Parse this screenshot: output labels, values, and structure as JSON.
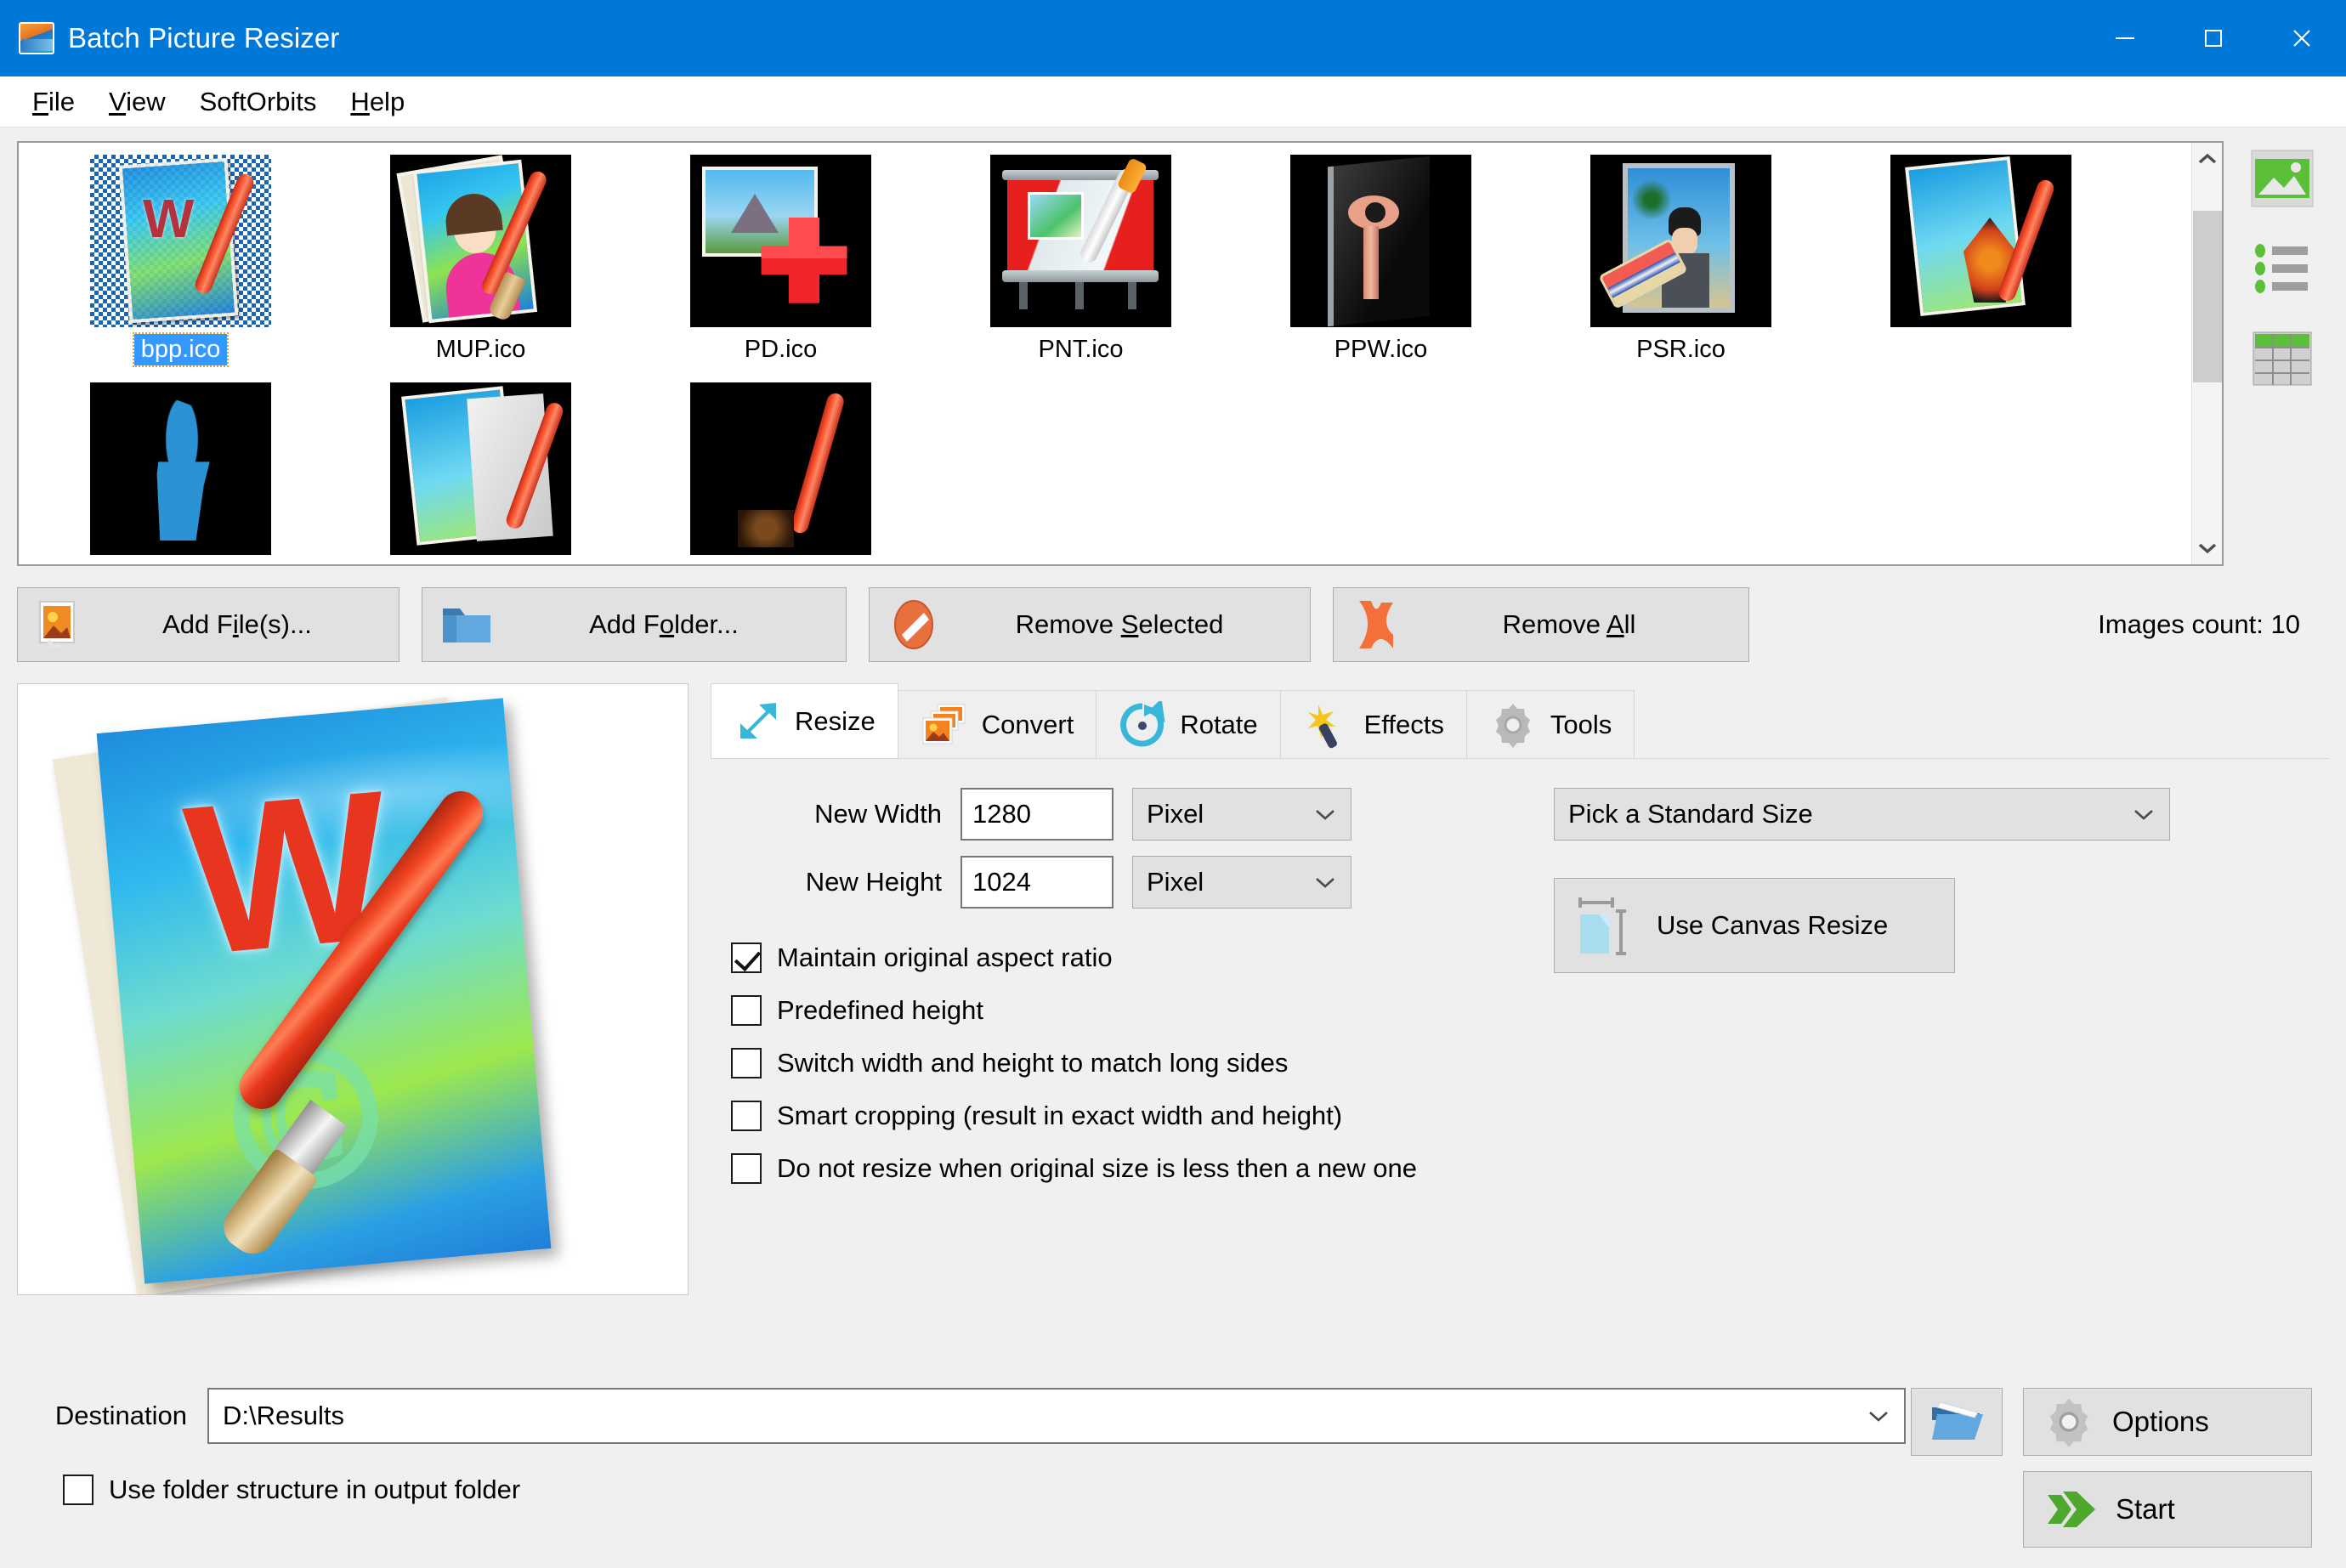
{
  "window": {
    "title": "Batch Picture Resizer",
    "icon": "app-image-icon",
    "minimize": "—",
    "maximize": "□",
    "close": "✕"
  },
  "menu": {
    "items": [
      {
        "label": "File",
        "accel": "F"
      },
      {
        "label": "View",
        "accel": "V"
      },
      {
        "label": "SoftOrbits",
        "accel": ""
      },
      {
        "label": "Help",
        "accel": "H"
      }
    ]
  },
  "thumbnails": {
    "items": [
      {
        "name": "bpp.ico",
        "selected": true
      },
      {
        "name": "MUP.ico",
        "selected": false
      },
      {
        "name": "PD.ico",
        "selected": false
      },
      {
        "name": "PNT.ico",
        "selected": false
      },
      {
        "name": "PPW.ico",
        "selected": false
      },
      {
        "name": "PSR.ico",
        "selected": false
      }
    ],
    "scrollbar": {
      "up": "chevron-up",
      "down": "chevron-down"
    }
  },
  "view_tools": {
    "items": [
      {
        "name": "thumbnail-view",
        "active": true
      },
      {
        "name": "list-view",
        "active": false
      },
      {
        "name": "details-view",
        "active": false
      }
    ]
  },
  "actions": {
    "add_files": "Add File(s)...",
    "add_folder": "Add Folder...",
    "remove_selected": "Remove Selected",
    "remove_all": "Remove All",
    "images_count": "Images count: 10"
  },
  "tabs": [
    {
      "label": "Resize",
      "icon": "resize-arrow-icon",
      "active": true
    },
    {
      "label": "Convert",
      "icon": "convert-photos-icon",
      "active": false
    },
    {
      "label": "Rotate",
      "icon": "rotate-arrow-icon",
      "active": false
    },
    {
      "label": "Effects",
      "icon": "magic-wand-icon",
      "active": false
    },
    {
      "label": "Tools",
      "icon": "gear-icon",
      "active": false
    }
  ],
  "resize": {
    "new_width_label": "New Width",
    "new_width_value": "1280",
    "new_width_unit": "Pixel",
    "new_height_label": "New Height",
    "new_height_value": "1024",
    "new_height_unit": "Pixel",
    "standard_size": "Pick a Standard Size",
    "canvas_resize": "Use Canvas Resize",
    "checkboxes": [
      {
        "label": "Maintain original aspect ratio",
        "checked": true
      },
      {
        "label": "Predefined height",
        "checked": false
      },
      {
        "label": "Switch width and height to match long sides",
        "checked": false
      },
      {
        "label": "Smart cropping (result in exact width and height)",
        "checked": false
      },
      {
        "label": "Do not resize when original size is less then a new one",
        "checked": false
      }
    ]
  },
  "footer": {
    "destination_label": "Destination",
    "destination_value": "D:\\Results",
    "use_folder_structure": "Use folder structure in output folder",
    "use_folder_structure_checked": false,
    "options": "Options",
    "start": "Start",
    "browse_icon": "open-folder-icon"
  },
  "colors": {
    "titlebar": "#0078d7",
    "selection": "#3399ff",
    "accent_green": "#55a83a",
    "accent_orange": "#f0782d",
    "panel_bg": "#f0f0f0"
  }
}
